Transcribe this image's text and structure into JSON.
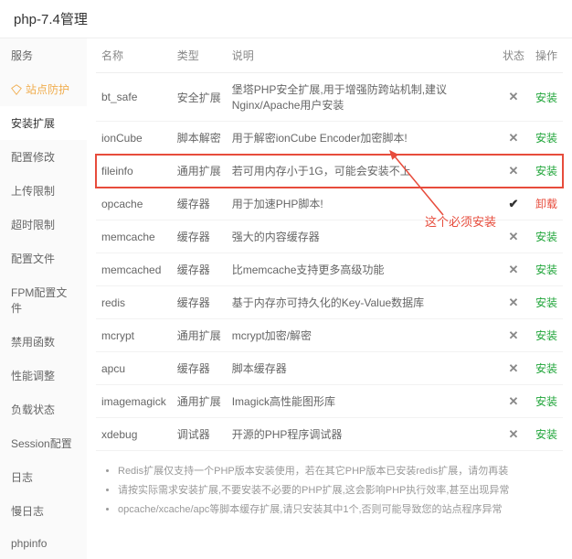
{
  "title": "php-7.4管理",
  "sidebar": {
    "items": [
      {
        "label": "服务"
      },
      {
        "label": "站点防护"
      },
      {
        "label": "安装扩展"
      },
      {
        "label": "配置修改"
      },
      {
        "label": "上传限制"
      },
      {
        "label": "超时限制"
      },
      {
        "label": "配置文件"
      },
      {
        "label": "FPM配置文件"
      },
      {
        "label": "禁用函数"
      },
      {
        "label": "性能调整"
      },
      {
        "label": "负载状态"
      },
      {
        "label": "Session配置"
      },
      {
        "label": "日志"
      },
      {
        "label": "慢日志"
      },
      {
        "label": "phpinfo"
      }
    ]
  },
  "table": {
    "headers": {
      "name": "名称",
      "type": "类型",
      "desc": "说明",
      "status": "状态",
      "action": "操作"
    },
    "rows": [
      {
        "name": "bt_safe",
        "type": "安全扩展",
        "desc": "堡塔PHP安全扩展,用于增强防跨站机制,建议Nginx/Apache用户安装",
        "installed": false,
        "action": "安装"
      },
      {
        "name": "ionCube",
        "type": "脚本解密",
        "desc": "用于解密ionCube Encoder加密脚本!",
        "installed": false,
        "action": "安装"
      },
      {
        "name": "fileinfo",
        "type": "通用扩展",
        "desc": "若可用内存小于1G，可能会安装不上",
        "installed": false,
        "action": "安装",
        "highlight": true
      },
      {
        "name": "opcache",
        "type": "缓存器",
        "desc": "用于加速PHP脚本!",
        "installed": true,
        "action": "卸载"
      },
      {
        "name": "memcache",
        "type": "缓存器",
        "desc": "强大的内容缓存器",
        "installed": false,
        "action": "安装"
      },
      {
        "name": "memcached",
        "type": "缓存器",
        "desc": "比memcache支持更多高级功能",
        "installed": false,
        "action": "安装"
      },
      {
        "name": "redis",
        "type": "缓存器",
        "desc": "基于内存亦可持久化的Key-Value数据库",
        "installed": false,
        "action": "安装"
      },
      {
        "name": "mcrypt",
        "type": "通用扩展",
        "desc": "mcrypt加密/解密",
        "installed": false,
        "action": "安装"
      },
      {
        "name": "apcu",
        "type": "缓存器",
        "desc": "脚本缓存器",
        "installed": false,
        "action": "安装"
      },
      {
        "name": "imagemagick",
        "type": "通用扩展",
        "desc": "Imagick高性能图形库",
        "installed": false,
        "action": "安装"
      },
      {
        "name": "xdebug",
        "type": "调试器",
        "desc": "开源的PHP程序调试器",
        "installed": false,
        "action": "安装"
      }
    ]
  },
  "notes": [
    "Redis扩展仅支持一个PHP版本安装使用，若在其它PHP版本已安装redis扩展，请勿再装",
    "请按实际需求安装扩展,不要安装不必要的PHP扩展,这会影响PHP执行效率,甚至出现异常",
    "opcache/xcache/apc等脚本缓存扩展,请只安装其中1个,否则可能导致您的站点程序异常"
  ],
  "annotation": "这个必须安装"
}
